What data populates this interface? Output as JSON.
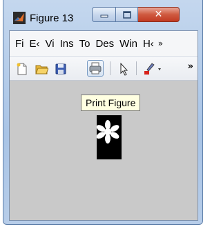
{
  "window": {
    "title": "Figure 13",
    "icons": {
      "app": "matlab-icon",
      "minimize": "minimize-icon",
      "maximize": "maximize-icon",
      "close": "close-icon"
    }
  },
  "menu": {
    "items": [
      "Fi",
      "E‹",
      "Vi",
      "Ins",
      "To",
      "Des",
      "Win",
      "H‹"
    ],
    "overflow": "»"
  },
  "toolbar": {
    "buttons": [
      {
        "name": "new-figure-icon"
      },
      {
        "name": "open-file-icon"
      },
      {
        "name": "save-icon"
      },
      {
        "name": "print-icon",
        "hovered": true
      },
      {
        "name": "pointer-icon"
      },
      {
        "name": "brush-icon"
      }
    ],
    "overflow": "»"
  },
  "tooltip": {
    "text": "Print Figure"
  },
  "colors": {
    "titlebar": "#b7cde9",
    "close": "#c23a22",
    "canvas": "#c9c9c9",
    "image": "#000000",
    "tooltip": "#ffffe1"
  }
}
